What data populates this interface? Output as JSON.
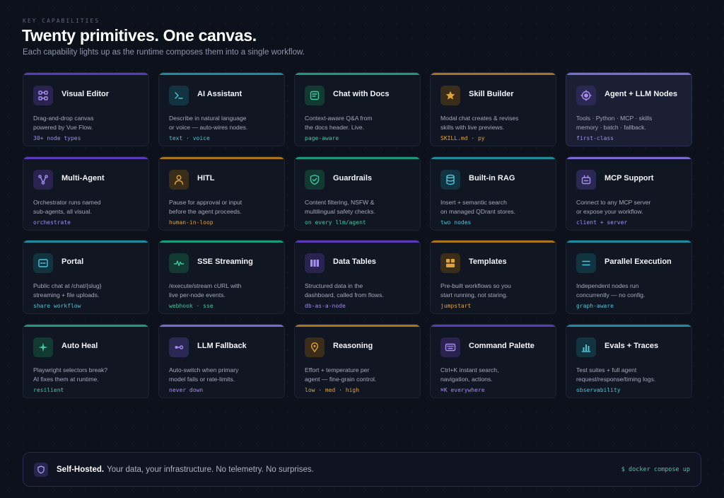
{
  "header": {
    "eyebrow": "KEY CAPABILITIES",
    "title": "Twenty primitives. One canvas.",
    "subtitle": "Each capability lights up as the runtime composes them into a single workflow."
  },
  "colors": {
    "purple": "#5b3bb8",
    "teal": "#1f8a99",
    "green": "#1a9a78",
    "amber": "#a8741c",
    "lavender": "#7a6ad0"
  },
  "cards": [
    {
      "title": "Visual Editor",
      "desc": [
        "Drag-and-drop canvas",
        "powered by Vue Flow."
      ],
      "tag": "30+ node types",
      "icon": "nodes-icon",
      "accent": "#5b3bb8",
      "icon_bg": "#2a2350",
      "icon_fg": "#a48ff0",
      "tag_color": "#9f8cf0"
    },
    {
      "title": "AI Assistant",
      "desc": [
        "Describe in natural language",
        "or voice — auto-wires nodes."
      ],
      "tag": "text · voice",
      "icon": "terminal-icon",
      "accent": "#1f8a99",
      "icon_bg": "#123440",
      "icon_fg": "#4cc4d8",
      "tag_color": "#4cc4d8"
    },
    {
      "title": "Chat with Docs",
      "desc": [
        "Context-aware Q&A from",
        "the docs header. Live."
      ],
      "tag": "page-aware",
      "icon": "doc-chat-icon",
      "accent": "#1a9a78",
      "icon_bg": "#123a33",
      "icon_fg": "#3ec9a0",
      "tag_color": "#3ec9a0"
    },
    {
      "title": "Skill Builder",
      "desc": [
        "Modal chat creates & revises",
        "skills with live previews."
      ],
      "tag": "SKILL.md · py",
      "icon": "star-icon",
      "accent": "#a8741c",
      "icon_bg": "#3a2e1a",
      "icon_fg": "#e2a23a",
      "tag_color": "#e2a23a"
    },
    {
      "title": "Agent + LLM Nodes",
      "desc": [
        "Tools · Python · MCP · skills",
        "memory · batch · fallback."
      ],
      "tag": "first-class",
      "icon": "agent-icon",
      "accent": "#7a6ad0",
      "icon_bg": "#2c2854",
      "icon_fg": "#a48ff0",
      "tag_color": "#a48ff0",
      "highlight": true
    },
    {
      "title": "Multi-Agent",
      "desc": [
        "Orchestrator runs named",
        "sub-agents, all visual."
      ],
      "tag": "orchestrate",
      "icon": "branch-icon",
      "accent": "#5b3bb8",
      "icon_bg": "#2a2350",
      "icon_fg": "#a48ff0",
      "tag_color": "#9f8cf0"
    },
    {
      "title": "HITL",
      "desc": [
        "Pause for approval or input",
        "before the agent proceeds."
      ],
      "tag": "human-in-loop",
      "icon": "person-icon",
      "accent": "#a8741c",
      "icon_bg": "#3a2e1a",
      "icon_fg": "#e2a23a",
      "tag_color": "#e2a23a"
    },
    {
      "title": "Guardrails",
      "desc": [
        "Content filtering, NSFW &",
        "multilingual safety checks."
      ],
      "tag": "on every llm/agent",
      "icon": "shield-check-icon",
      "accent": "#1a9a78",
      "icon_bg": "#123a33",
      "icon_fg": "#3ec9a0",
      "tag_color": "#3ec9a0"
    },
    {
      "title": "Built-in RAG",
      "desc": [
        "Insert + semantic search",
        "on managed QDrant stores."
      ],
      "tag": "two nodes",
      "icon": "database-icon",
      "accent": "#1f8a99",
      "icon_bg": "#123440",
      "icon_fg": "#4cc4d8",
      "tag_color": "#4cc4d8"
    },
    {
      "title": "MCP Support",
      "desc": [
        "Connect to any MCP server",
        "or expose your workflow."
      ],
      "tag": "client + server",
      "icon": "plug-icon",
      "accent": "#7a6ad0",
      "icon_bg": "#2c2854",
      "icon_fg": "#a48ff0",
      "tag_color": "#a48ff0"
    },
    {
      "title": "Portal",
      "desc": [
        "Public chat at /chat/{slug}",
        "streaming + file uploads."
      ],
      "tag": "share workflow",
      "icon": "window-icon",
      "accent": "#1f8a99",
      "icon_bg": "#123440",
      "icon_fg": "#4cc4d8",
      "tag_color": "#4cc4d8"
    },
    {
      "title": "SSE Streaming",
      "desc": [
        "/execute/stream cURL with",
        "live per-node events."
      ],
      "tag": "webhook · sse",
      "icon": "pulse-icon",
      "accent": "#1a9a78",
      "icon_bg": "#123a33",
      "icon_fg": "#3ec9a0",
      "tag_color": "#3ec9a0"
    },
    {
      "title": "Data Tables",
      "desc": [
        "Structured data in the",
        "dashboard, called from flows."
      ],
      "tag": "db-as-a-node",
      "icon": "table-icon",
      "accent": "#5b3bb8",
      "icon_bg": "#2a2350",
      "icon_fg": "#a48ff0",
      "tag_color": "#9f8cf0"
    },
    {
      "title": "Templates",
      "desc": [
        "Pre-built workflows so you",
        "start running, not staring."
      ],
      "tag": "jumpstart",
      "icon": "grid-icon",
      "accent": "#a8741c",
      "icon_bg": "#3a2e1a",
      "icon_fg": "#e2a23a",
      "tag_color": "#e2a23a"
    },
    {
      "title": "Parallel Execution",
      "desc": [
        "Independent nodes run",
        "concurrently — no config."
      ],
      "tag": "graph-aware",
      "icon": "parallel-icon",
      "accent": "#1f8a99",
      "icon_bg": "#123440",
      "icon_fg": "#4cc4d8",
      "tag_color": "#4cc4d8"
    },
    {
      "title": "Auto Heal",
      "desc": [
        "Playwright selectors break?",
        "AI fixes them at runtime."
      ],
      "tag": "resilient",
      "icon": "sparkle-icon",
      "accent": "#1a9a78",
      "icon_bg": "#123a33",
      "icon_fg": "#3ec9a0",
      "tag_color": "#3ec9a0"
    },
    {
      "title": "LLM Fallback",
      "desc": [
        "Auto-switch when primary",
        "model fails or rate-limits."
      ],
      "tag": "never down",
      "icon": "switch-icon",
      "accent": "#7a6ad0",
      "icon_bg": "#2c2854",
      "icon_fg": "#a48ff0",
      "tag_color": "#a48ff0"
    },
    {
      "title": "Reasoning",
      "desc": [
        "Effort + temperature per",
        "agent — fine-grain control."
      ],
      "tag": "low · med · high",
      "icon": "bulb-icon",
      "accent": "#a8741c",
      "icon_bg": "#3a2e1a",
      "icon_fg": "#e2a23a",
      "tag_color": "#e2a23a"
    },
    {
      "title": "Command Palette",
      "desc": [
        "Ctrl+K instant search,",
        "navigation, actions."
      ],
      "tag": "⌘K everywhere",
      "icon": "keyboard-icon",
      "accent": "#5b3bb8",
      "icon_bg": "#2a2350",
      "icon_fg": "#a48ff0",
      "tag_color": "#9f8cf0"
    },
    {
      "title": "Evals + Traces",
      "desc": [
        "Test suites + full agent",
        "request/response/timing logs."
      ],
      "tag": "observability",
      "icon": "bar-chart-icon",
      "accent": "#1f8a99",
      "icon_bg": "#123440",
      "icon_fg": "#4cc4d8",
      "tag_color": "#4cc4d8"
    }
  ],
  "footer": {
    "strong": "Self-Hosted.",
    "text": "Your data, your infrastructure. No telemetry. No surprises.",
    "command": "$ docker compose up",
    "icon": "shield-icon"
  }
}
